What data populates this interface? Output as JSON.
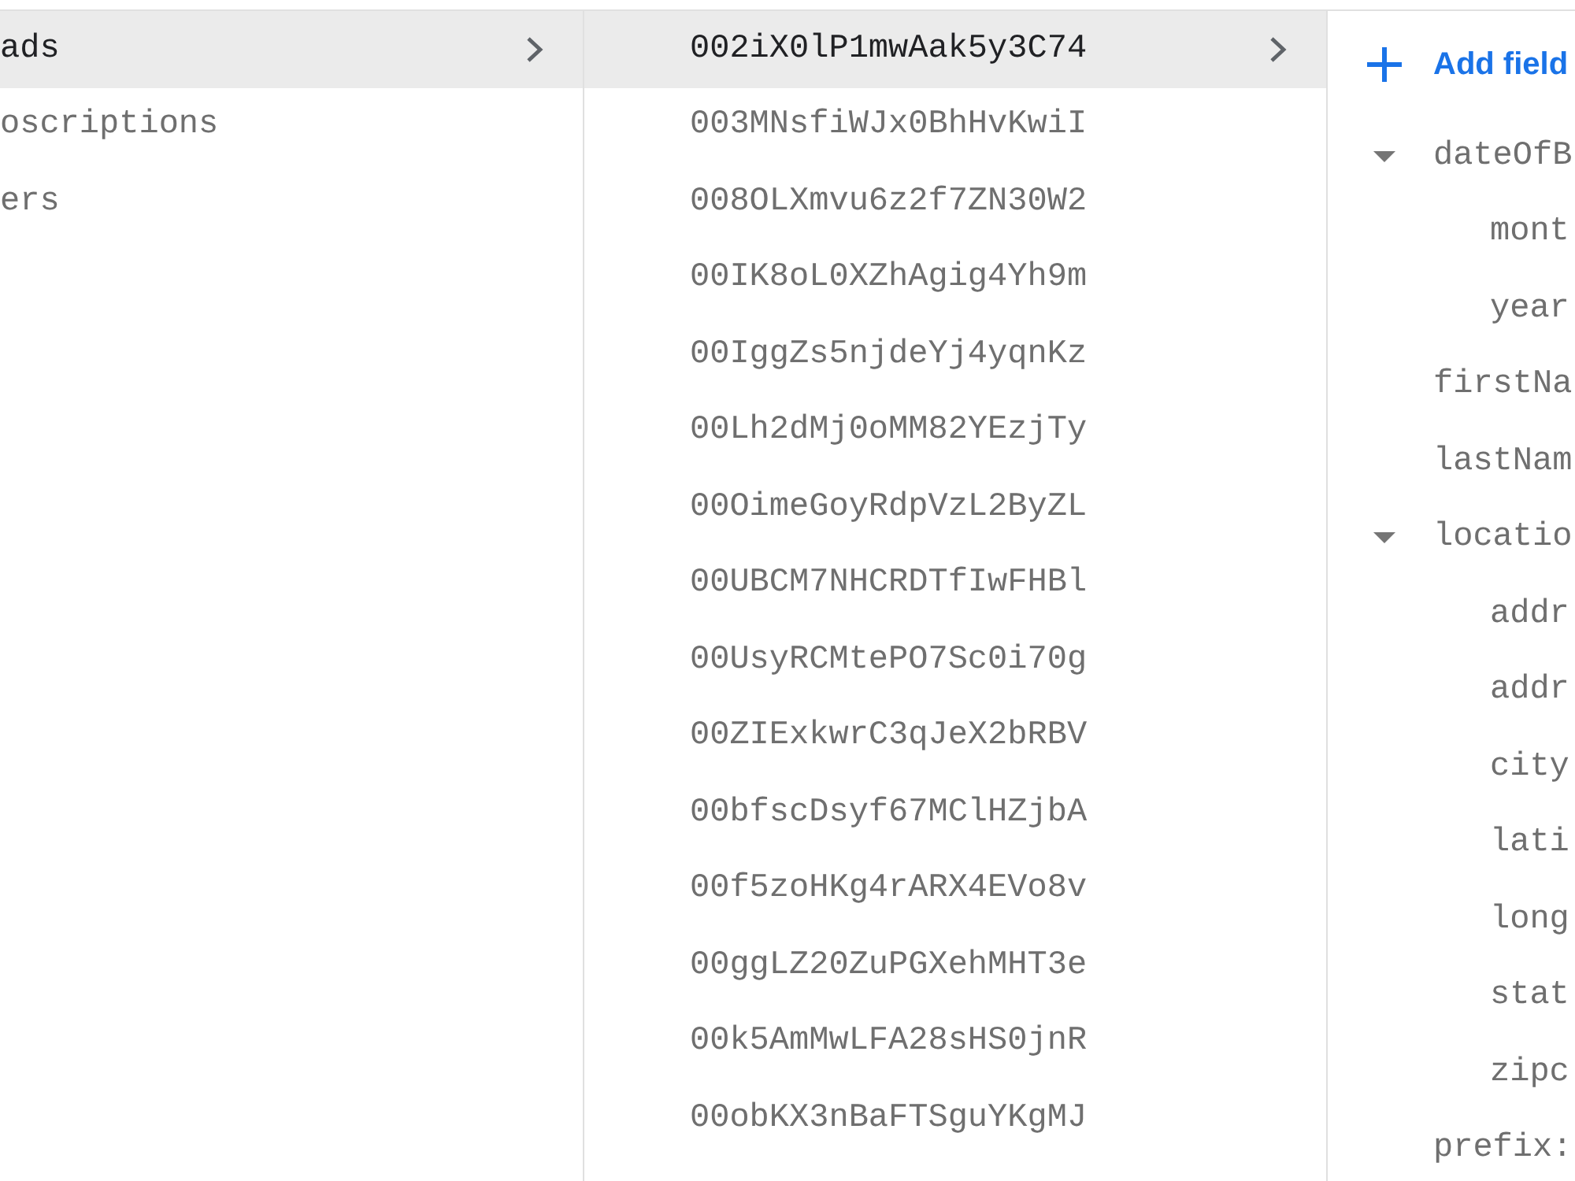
{
  "collections": {
    "items": [
      {
        "label": "ads",
        "selected": true
      },
      {
        "label": "oscriptions",
        "selected": false
      },
      {
        "label": "ers",
        "selected": false
      }
    ]
  },
  "documents": {
    "items": [
      {
        "id": "002iX0lP1mwAak5y3C74",
        "selected": true
      },
      {
        "id": "003MNsfiWJx0BhHvKwiI",
        "selected": false
      },
      {
        "id": "008OLXmvu6z2f7ZN30W2",
        "selected": false
      },
      {
        "id": "00IK8oL0XZhAgig4Yh9m",
        "selected": false
      },
      {
        "id": "00IggZs5njdeYj4yqnKz",
        "selected": false
      },
      {
        "id": "00Lh2dMj0oMM82YEzjTy",
        "selected": false
      },
      {
        "id": "00OimeGoyRdpVzL2ByZL",
        "selected": false
      },
      {
        "id": "00UBCM7NHCRDTfIwFHBl",
        "selected": false
      },
      {
        "id": "00UsyRCMtePO7Sc0i70g",
        "selected": false
      },
      {
        "id": "00ZIExkwrC3qJeX2bRBV",
        "selected": false
      },
      {
        "id": "00bfscDsyf67MClHZjbA",
        "selected": false
      },
      {
        "id": "00f5zoHKg4rARX4EVo8v",
        "selected": false
      },
      {
        "id": "00ggLZ20ZuPGXehMHT3e",
        "selected": false
      },
      {
        "id": "00k5AmMwLFA28sHS0jnR",
        "selected": false
      },
      {
        "id": "00obKX3nBaFTSguYKgMJ",
        "selected": false
      }
    ]
  },
  "fields_panel": {
    "add_field_label": "Add field",
    "fields": [
      {
        "name": "dateOfB",
        "expanded": true,
        "children": [
          {
            "name": "mont"
          },
          {
            "name": "year"
          }
        ]
      },
      {
        "name": "firstNa"
      },
      {
        "name": "lastNam"
      },
      {
        "name": "locatio",
        "expanded": true,
        "children": [
          {
            "name": "addr"
          },
          {
            "name": "addr"
          },
          {
            "name": "city"
          },
          {
            "name": "lati"
          },
          {
            "name": "long"
          },
          {
            "name": "stat"
          },
          {
            "name": "zipc"
          }
        ]
      },
      {
        "name": "prefix:"
      }
    ]
  }
}
